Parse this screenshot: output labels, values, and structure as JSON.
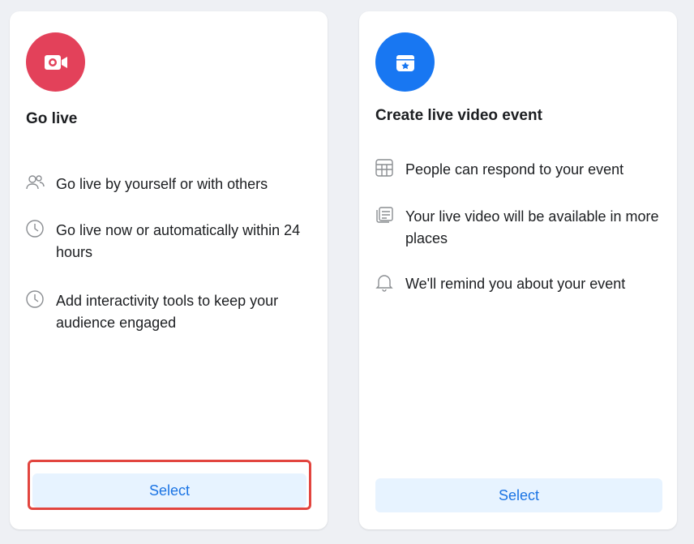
{
  "cards": [
    {
      "title": "Go live",
      "icon": "video-camera-icon",
      "accent_color": "#e3415a",
      "features": [
        {
          "icon": "people-icon",
          "text": "Go live by yourself or with others"
        },
        {
          "icon": "clock-icon",
          "text": "Go live now or automatically within 24 hours"
        },
        {
          "icon": "clock-icon",
          "text": "Add interactivity tools to keep your audience engaged"
        }
      ],
      "button_label": "Select",
      "highlighted": true
    },
    {
      "title": "Create live video event",
      "icon": "calendar-star-icon",
      "accent_color": "#1877f2",
      "features": [
        {
          "icon": "grid-icon",
          "text": "People can respond to your event"
        },
        {
          "icon": "video-cards-icon",
          "text": "Your live video will be available in more places"
        },
        {
          "icon": "bell-icon",
          "text": "We'll remind you about your event"
        }
      ],
      "button_label": "Select",
      "highlighted": false
    }
  ],
  "colors": {
    "button_bg": "#e7f3ff",
    "button_text": "#1b74e4",
    "highlight_border": "#e2453f"
  }
}
